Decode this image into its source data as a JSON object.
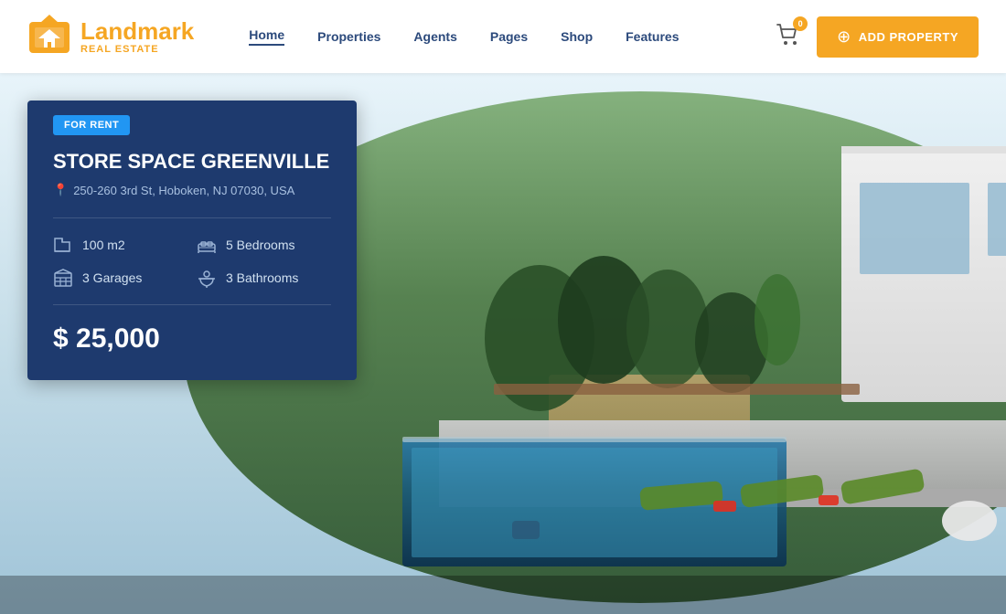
{
  "header": {
    "logo": {
      "name_part1": "Land",
      "name_part2": "mark",
      "subtitle": "Real Estate"
    },
    "nav": {
      "items": [
        {
          "label": "Home",
          "active": true
        },
        {
          "label": "Properties",
          "active": false
        },
        {
          "label": "Agents",
          "active": false
        },
        {
          "label": "Pages",
          "active": false
        },
        {
          "label": "Shop",
          "active": false
        },
        {
          "label": "Features",
          "active": false
        }
      ]
    },
    "cart": {
      "badge": "0"
    },
    "add_property_btn": "ADD PROPERTY"
  },
  "hero": {
    "property": {
      "badge": "FOR RENT",
      "title": "STORE SPACE GREENVILLE",
      "address": "250-260 3rd St, Hoboken, NJ 07030, USA",
      "features": [
        {
          "icon": "area-icon",
          "label": "100 m2"
        },
        {
          "icon": "bed-icon",
          "label": "5 Bedrooms"
        },
        {
          "icon": "garage-icon",
          "label": "3 Garages"
        },
        {
          "icon": "bath-icon",
          "label": "3 Bathrooms"
        }
      ],
      "price": "$ 25,000"
    }
  }
}
